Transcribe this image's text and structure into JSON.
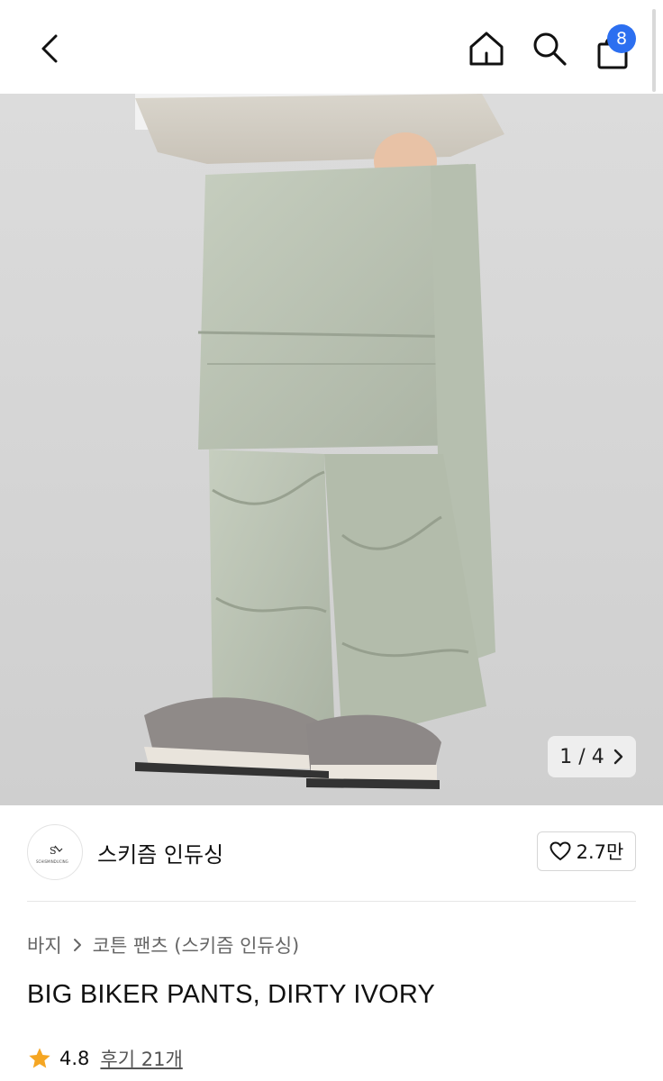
{
  "header": {
    "cart_count": "8",
    "icons": [
      "back-arrow-icon",
      "home-icon",
      "search-icon",
      "shopping-bag-icon"
    ]
  },
  "gallery": {
    "current": "1",
    "separator": "/",
    "total": "4",
    "counter_text": "1 / 4"
  },
  "seller": {
    "name": "스키즘 인듀싱",
    "logo_text": "SCHISMINDUCING",
    "likes": "2.7만"
  },
  "breadcrumb": {
    "category": "바지",
    "subcategory": "코튼 팬츠 (스키즘 인듀싱)"
  },
  "product": {
    "title": "BIG BIKER PANTS, DIRTY IVORY",
    "rating": "4.8",
    "reviews": "후기 21개"
  },
  "colors": {
    "accent_blue": "#2c6ff0",
    "star": "#f5a623",
    "product_sage": "#b8c1b0"
  }
}
